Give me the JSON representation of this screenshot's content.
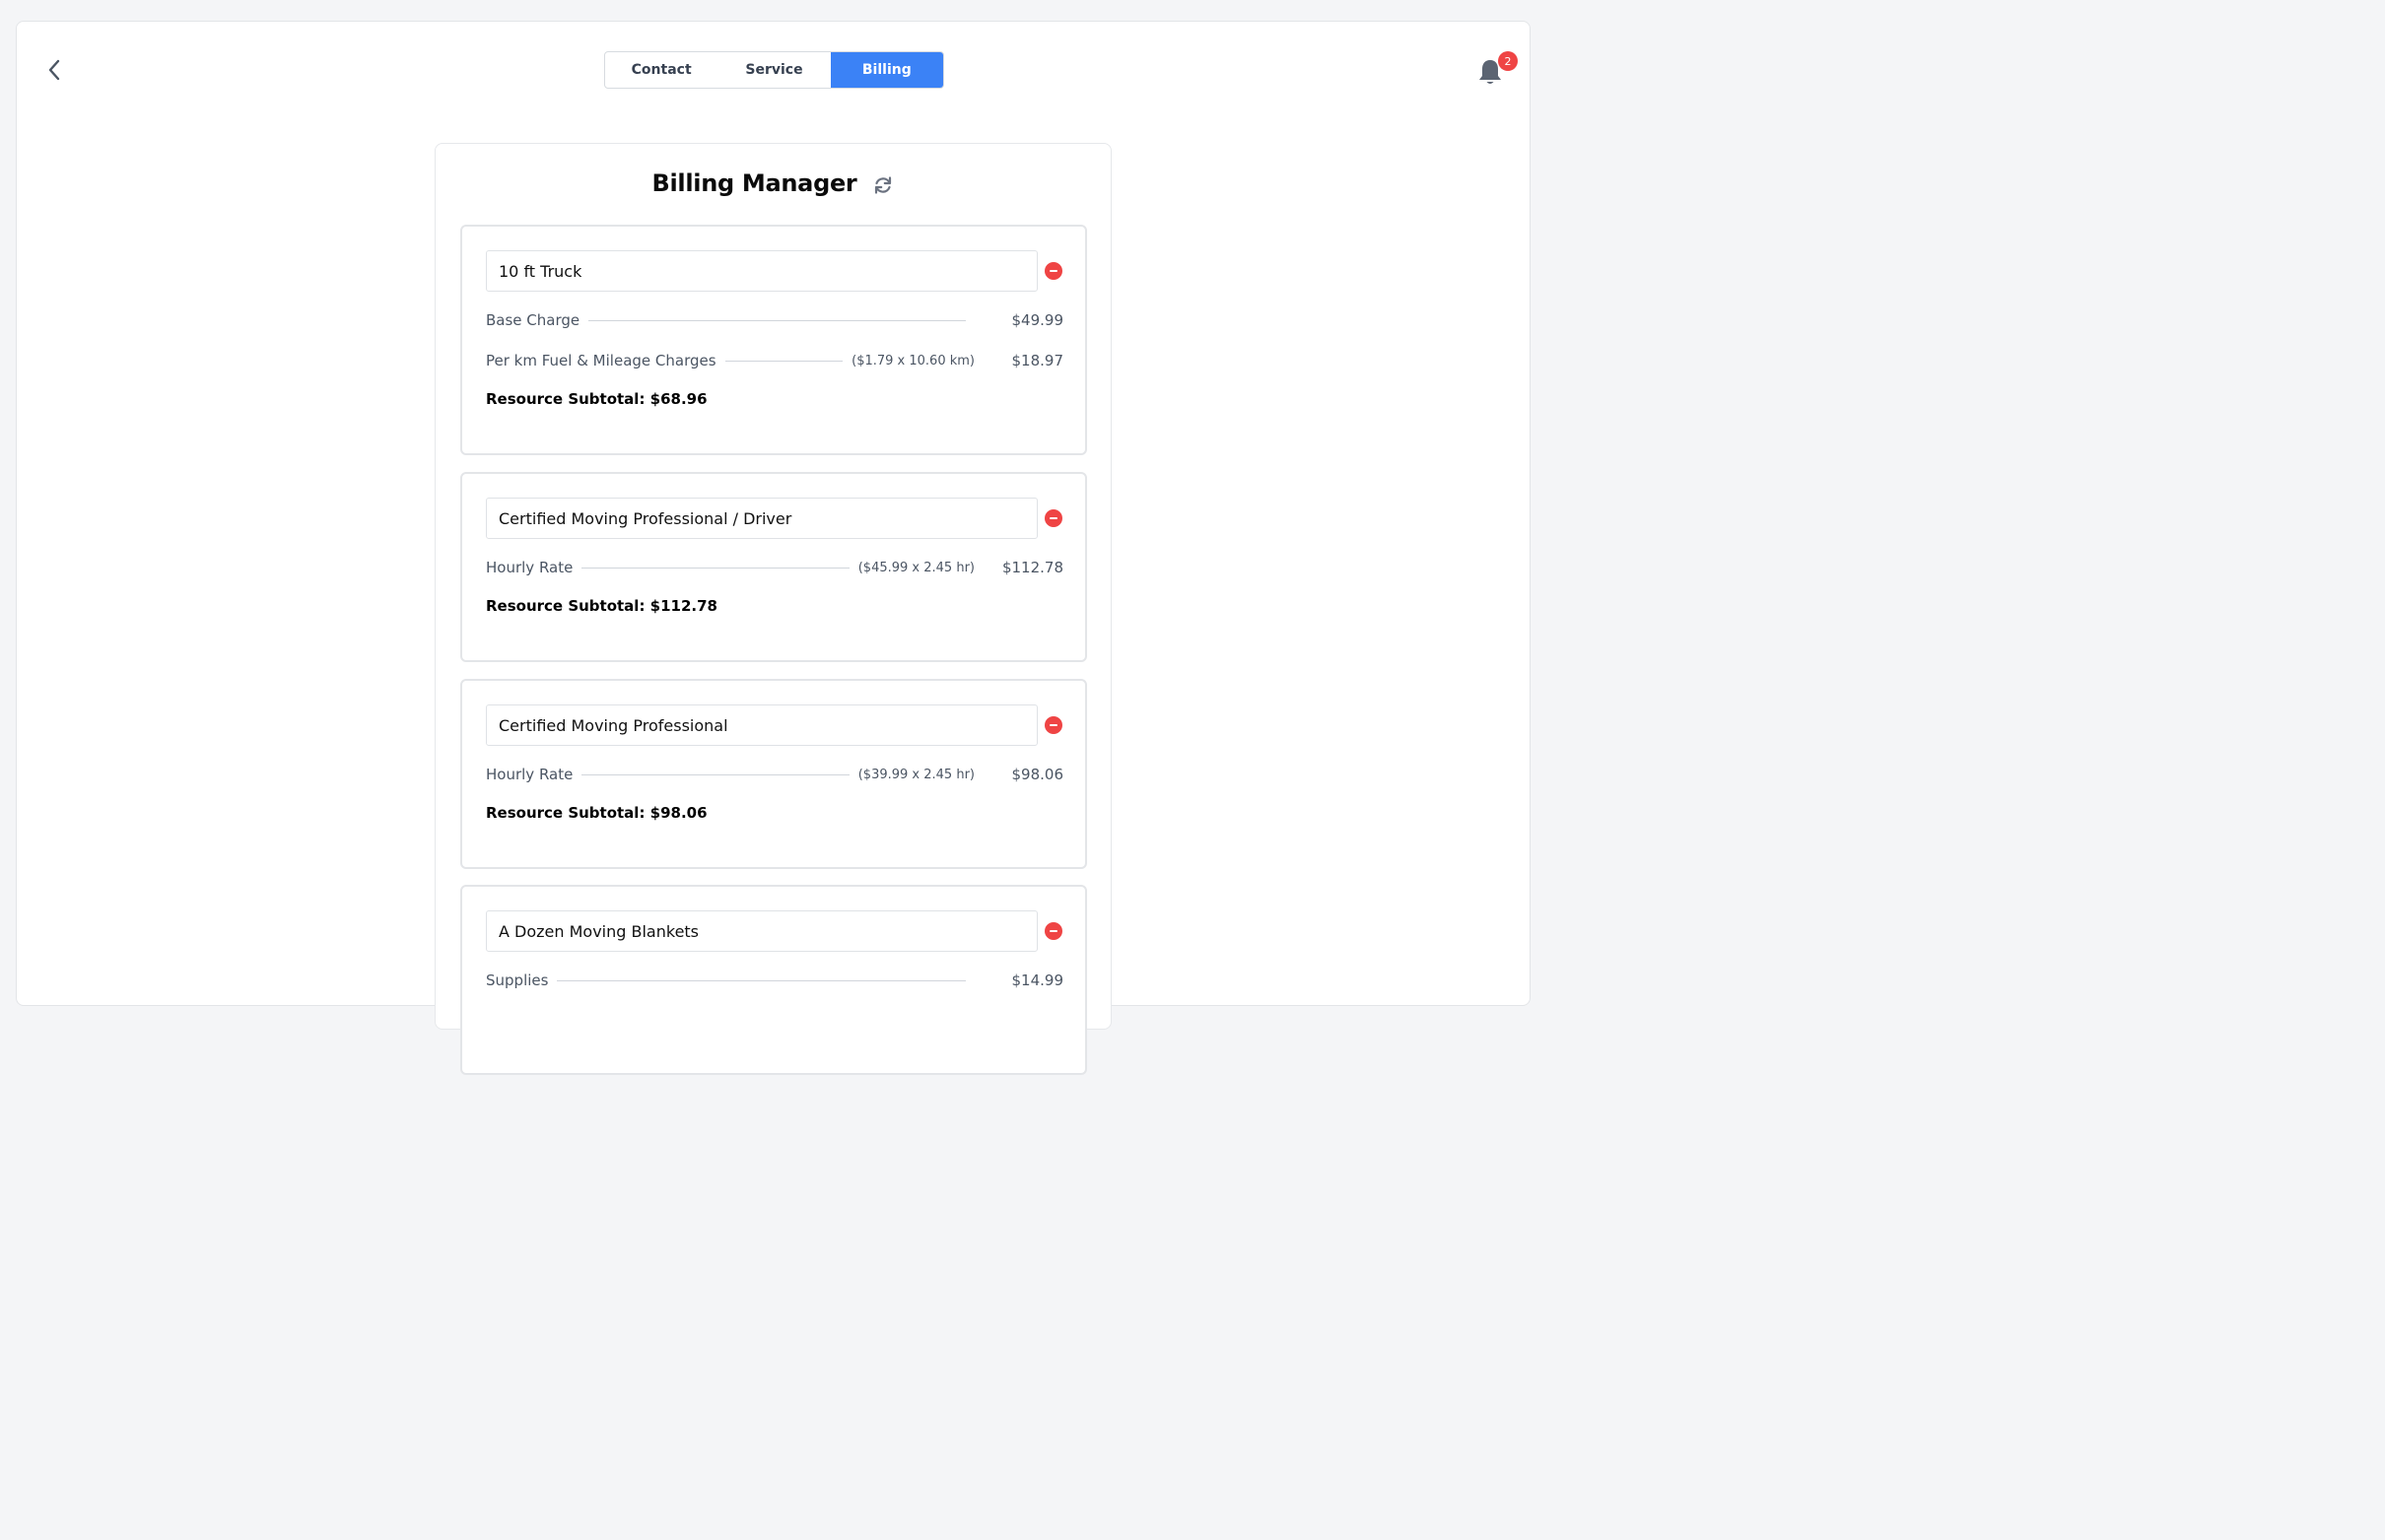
{
  "nav": {
    "back_icon": "chevron-left-icon",
    "tabs": [
      {
        "label": "Contact",
        "active": false
      },
      {
        "label": "Service",
        "active": false
      },
      {
        "label": "Billing",
        "active": true
      }
    ],
    "notifications": {
      "icon": "bell-icon",
      "count": "2"
    }
  },
  "billing": {
    "title": "Billing Manager",
    "refresh_icon": "refresh-icon",
    "resources": [
      {
        "name": "10 ft Truck",
        "lines": [
          {
            "label": "Base Charge",
            "calc": "",
            "amount": "$49.99"
          },
          {
            "label": "Per km Fuel & Mileage Charges",
            "calc": "($1.79 x 10.60 km)",
            "amount": "$18.97"
          }
        ],
        "subtotal": "Resource Subtotal: $68.96"
      },
      {
        "name": "Certified Moving Professional / Driver",
        "lines": [
          {
            "label": "Hourly Rate",
            "calc": "($45.99 x 2.45 hr)",
            "amount": "$112.78"
          }
        ],
        "subtotal": "Resource Subtotal: $112.78"
      },
      {
        "name": "Certified Moving Professional",
        "lines": [
          {
            "label": "Hourly Rate",
            "calc": "($39.99 x 2.45 hr)",
            "amount": "$98.06"
          }
        ],
        "subtotal": "Resource Subtotal: $98.06"
      },
      {
        "name": "A Dozen Moving Blankets",
        "lines": [
          {
            "label": "Supplies",
            "calc": "",
            "amount": "$14.99"
          }
        ],
        "subtotal": ""
      }
    ]
  },
  "colors": {
    "accent": "#3b82f6",
    "danger": "#ef4444"
  }
}
